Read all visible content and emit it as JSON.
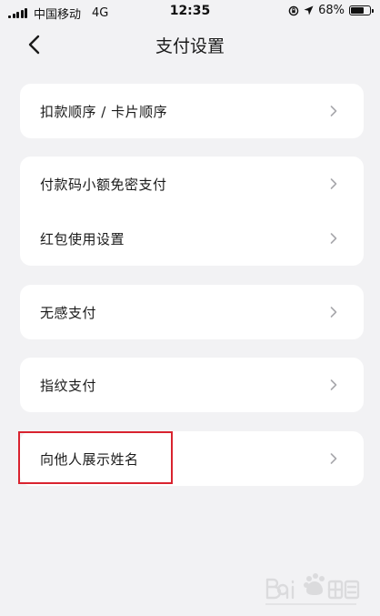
{
  "status_bar": {
    "carrier": "中国移动",
    "network": "4G",
    "time": "12:35",
    "battery": "68%"
  },
  "nav": {
    "title": "支付设置"
  },
  "settings": {
    "group1": [
      "扣款顺序 / 卡片顺序"
    ],
    "group2": [
      "付款码小额免密支付",
      "红包使用设置"
    ],
    "group3": [
      "无感支付"
    ],
    "group4": [
      "指纹支付"
    ],
    "group5": [
      "向他人展示姓名"
    ]
  },
  "colors": {
    "background": "#f2f2f4",
    "card": "#ffffff",
    "highlight": "#d9232f",
    "chevron": "#a8a8ac"
  },
  "icons": {
    "back": "chevron-left-icon",
    "row_arrow": "chevron-right-icon",
    "location": "location-arrow-icon",
    "lock": "orientation-lock-icon",
    "battery": "battery-icon",
    "signal": "signal-icon"
  }
}
